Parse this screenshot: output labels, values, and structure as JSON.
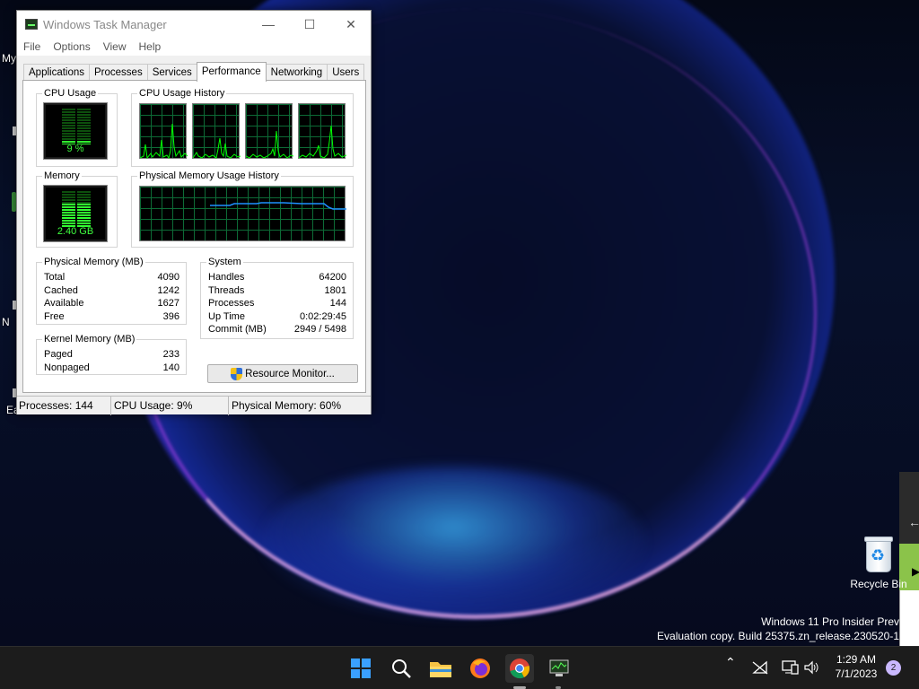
{
  "window": {
    "title": "Windows Task Manager",
    "menu": [
      "File",
      "Options",
      "View",
      "Help"
    ],
    "tabs": [
      "Applications",
      "Processes",
      "Services",
      "Performance",
      "Networking",
      "Users"
    ],
    "active_tab": "Performance"
  },
  "performance": {
    "cpu_usage_label": "CPU Usage",
    "cpu_usage_value": "9 %",
    "cpu_history_label": "CPU Usage History",
    "memory_label": "Memory",
    "memory_value": "2.40 GB",
    "phys_history_label": "Physical Memory Usage History",
    "physical_memory": {
      "label": "Physical Memory (MB)",
      "rows": [
        {
          "k": "Total",
          "v": "4090"
        },
        {
          "k": "Cached",
          "v": "1242"
        },
        {
          "k": "Available",
          "v": "1627"
        },
        {
          "k": "Free",
          "v": "396"
        }
      ]
    },
    "kernel_memory": {
      "label": "Kernel Memory (MB)",
      "rows": [
        {
          "k": "Paged",
          "v": "233"
        },
        {
          "k": "Nonpaged",
          "v": "140"
        }
      ]
    },
    "system": {
      "label": "System",
      "rows": [
        {
          "k": "Handles",
          "v": "64200"
        },
        {
          "k": "Threads",
          "v": "1801"
        },
        {
          "k": "Processes",
          "v": "144"
        },
        {
          "k": "Up Time",
          "v": "0:02:29:45"
        },
        {
          "k": "Commit (MB)",
          "v": "2949 / 5498"
        }
      ]
    },
    "resource_monitor_label": "Resource Monitor..."
  },
  "status_bar": {
    "processes": "Processes: 144",
    "cpu": "CPU Usage: 9%",
    "memory": "Physical Memory: 60%"
  },
  "desktop": {
    "recycle_bin_label": "Recycle Bin",
    "left_edge_texts": [
      "My",
      "N",
      "Ea"
    ],
    "watermark_line1": "Windows 11 Pro Insider Prev",
    "watermark_line2": "Evaluation copy. Build 25375.zn_release.230520-1"
  },
  "taskbar": {
    "icons": [
      "start-icon",
      "search-icon",
      "file-explorer-icon",
      "firefox-icon",
      "chrome-icon",
      "task-manager-icon"
    ],
    "time": "1:29 AM",
    "date": "7/1/2023",
    "notification_count": "2"
  },
  "colors": {
    "graph_line": "#00ff00",
    "memory_line": "#1e90ff",
    "grid": "#0d6b36"
  }
}
